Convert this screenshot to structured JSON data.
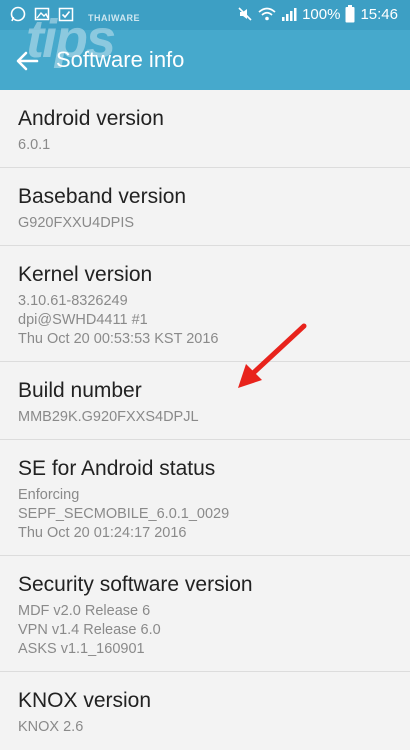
{
  "status_bar": {
    "battery_percent": "100%",
    "time": "15:46"
  },
  "watermark": {
    "brand": "THAIWARE",
    "text": "tips"
  },
  "app_bar": {
    "title": "Software info"
  },
  "items": [
    {
      "title": "Android version",
      "value": "6.0.1"
    },
    {
      "title": "Baseband version",
      "value": "G920FXXU4DPIS"
    },
    {
      "title": "Kernel version",
      "value": "3.10.61-8326249\ndpi@SWHD4411 #1\nThu Oct 20 00:53:53 KST 2016"
    },
    {
      "title": "Build number",
      "value": "MMB29K.G920FXXS4DPJL"
    },
    {
      "title": "SE for Android status",
      "value": "Enforcing\nSEPF_SECMOBILE_6.0.1_0029\nThu Oct 20 01:24:17 2016"
    },
    {
      "title": "Security software version",
      "value": "MDF v2.0 Release 6\nVPN v1.4 Release 6.0\nASKS v1.1_160901"
    },
    {
      "title": "KNOX version",
      "value": "KNOX 2.6"
    }
  ],
  "colors": {
    "status_bar": "#3d9fc4",
    "app_bar": "#46a9cc",
    "background": "#f3f3f3",
    "arrow": "#e8231c"
  },
  "icons": [
    "whatsapp-icon",
    "image-icon",
    "check-icon",
    "mute-icon",
    "wifi-icon",
    "signal-icon",
    "battery-icon",
    "back-arrow-icon"
  ]
}
